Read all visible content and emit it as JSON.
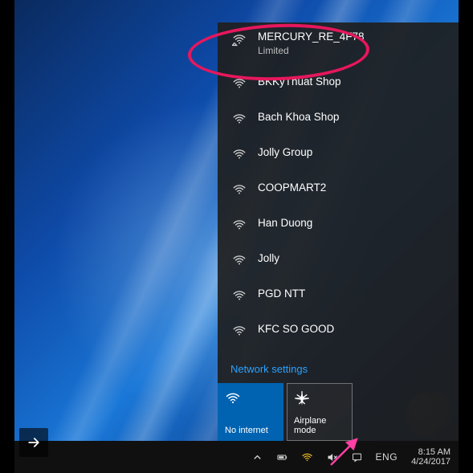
{
  "networks": [
    {
      "name": "MERCURY_RE_4F78",
      "status": "Limited",
      "limited": true
    },
    {
      "name": "BKKyThuat Shop"
    },
    {
      "name": "Bach Khoa Shop"
    },
    {
      "name": "Jolly Group"
    },
    {
      "name": "COOPMART2"
    },
    {
      "name": "Han Duong"
    },
    {
      "name": "Jolly"
    },
    {
      "name": "PGD NTT"
    },
    {
      "name": "KFC SO GOOD"
    }
  ],
  "settings_link": "Network settings",
  "tiles": {
    "no_internet": "No internet",
    "airplane": "Airplane mode"
  },
  "tray": {
    "lang": "ENG",
    "time": "8:15 AM",
    "date": "4/24/2017"
  }
}
